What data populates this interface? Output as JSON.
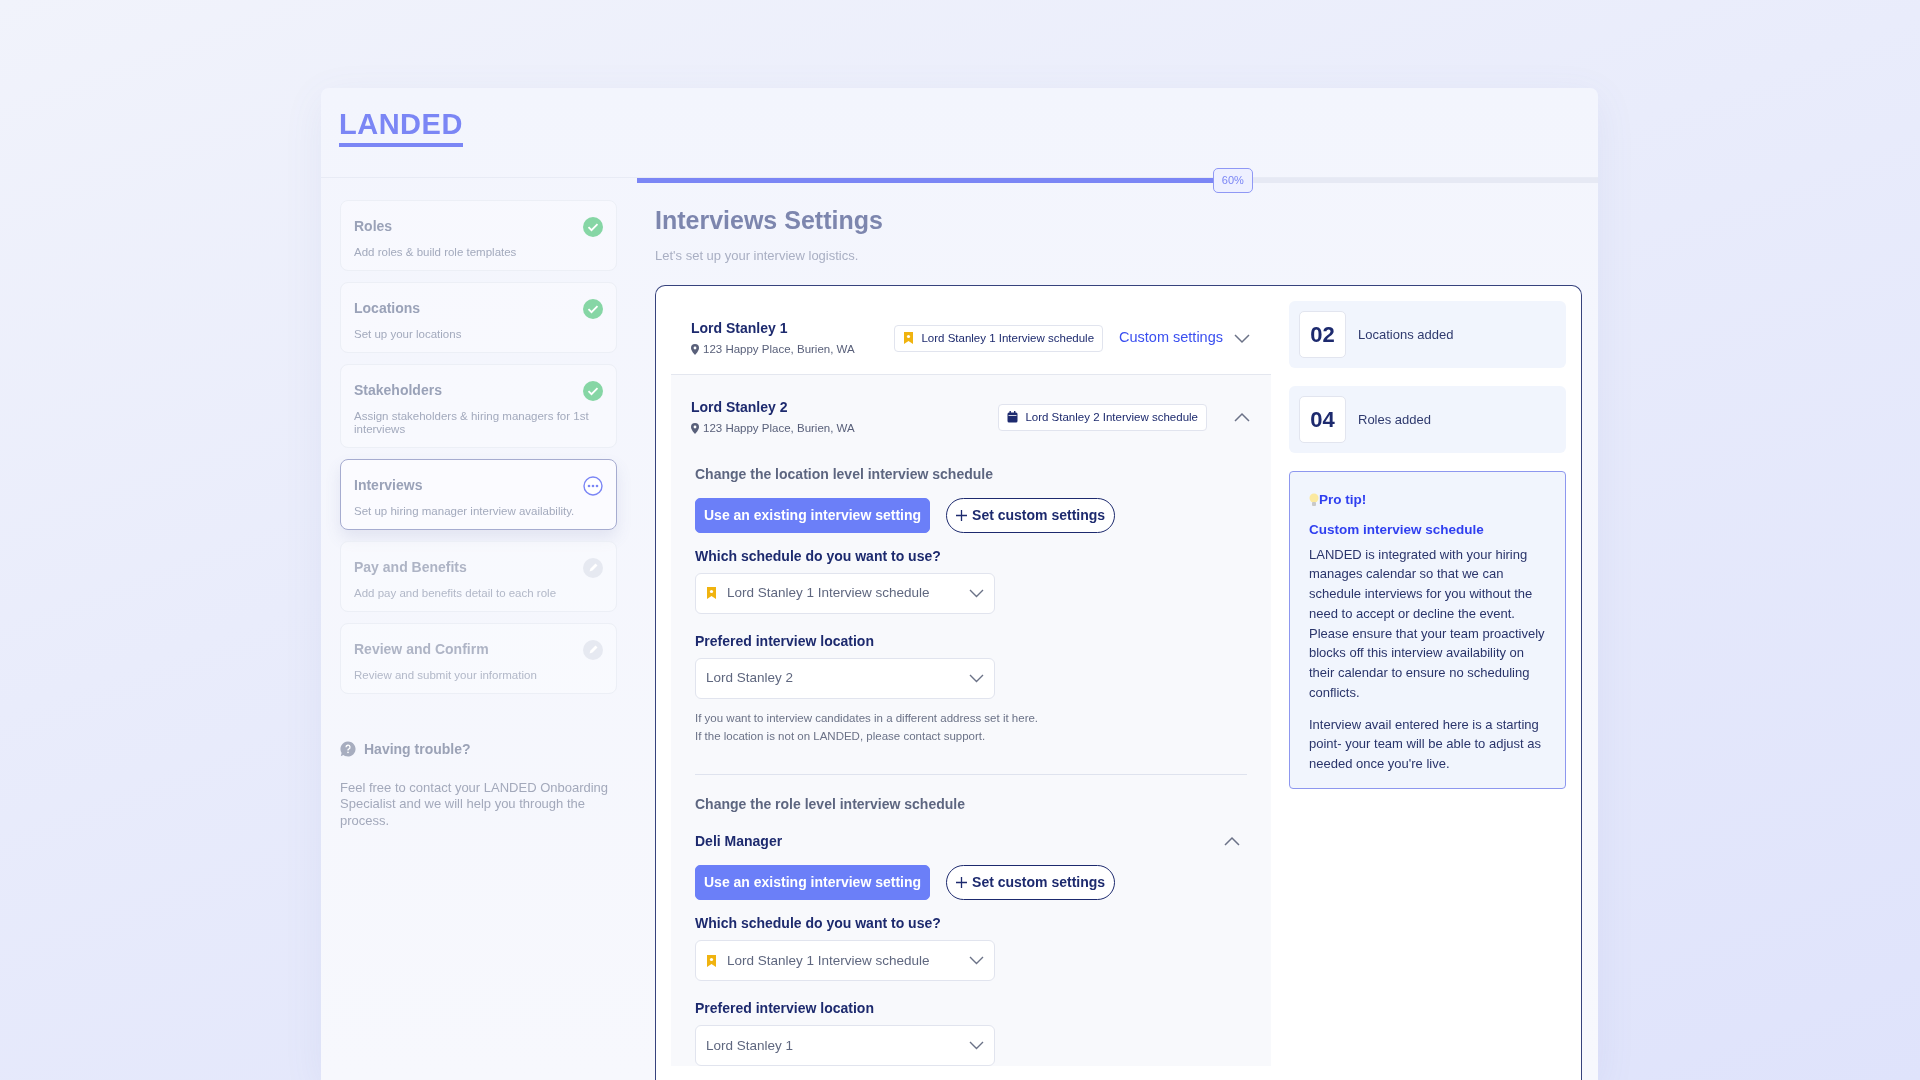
{
  "logo": "LANDED",
  "steps": [
    {
      "title": "Roles",
      "subtitle": "Add roles & build role templates",
      "completed": true,
      "selected": false
    },
    {
      "title": "Locations",
      "subtitle": "Set up your locations",
      "completed": true,
      "selected": false
    },
    {
      "title": "Stakeholders",
      "subtitle": "Assign stakeholders & hiring managers for 1st interviews",
      "completed": true,
      "selected": false
    },
    {
      "title": "Interviews",
      "subtitle": "Set up hiring manager interview availability.",
      "completed": false,
      "selected": true
    },
    {
      "title": "Pay and Benefits",
      "subtitle": "Add pay and benefits detail to each role",
      "completed": false,
      "selected": false
    },
    {
      "title": "Review and Confirm",
      "subtitle": "Review and submit your information",
      "completed": false,
      "selected": false
    }
  ],
  "help": {
    "title": "Having trouble?",
    "text": "Feel free to contact your LANDED Onboarding Specialist and we will help you through the process."
  },
  "progress": {
    "level": 0.6,
    "label": "60%"
  },
  "page": {
    "title": "Interviews Settings",
    "subtitle": "Let's set up your interview logistics."
  },
  "locations": [
    {
      "name": "Lord Stanley 1",
      "address": "123 Happy Place, Burien, WA",
      "schedule": {
        "kind": "bookmark",
        "label": "Lord Stanley 1 Interview schedule"
      },
      "link": "Custom settings",
      "expanded": false
    },
    {
      "name": "Lord Stanley 2",
      "address": "123 Happy Place, Burien, WA",
      "schedule": {
        "kind": "calendar",
        "label": "Lord Stanley 2 Interview schedule"
      },
      "expanded": true,
      "location_section": {
        "heading": "Change the location level interview schedule",
        "form": {
          "options": [
            {
              "label": "Use an existing interview setting",
              "selected": true
            },
            {
              "label": "Set custom settings",
              "selected": false
            }
          ],
          "schedule_label": "Which schedule do you want to use?",
          "schedule": {
            "kind": "bookmark",
            "value": "Lord Stanley 1 Interview schedule"
          },
          "location_label": "Prefered interview location",
          "location_value": "Lord Stanley 2",
          "help": [
            "If you want to interview candidates in a different address set it here.",
            "If the location is not on LANDED, please contact support."
          ]
        }
      },
      "role_section": {
        "heading": "Change the role level interview schedule",
        "roles": [
          {
            "name": "Deli Manager",
            "expanded": true,
            "form": {
              "options": [
                {
                  "label": "Use an existing interview setting",
                  "selected": true
                },
                {
                  "label": "Set custom settings",
                  "selected": false
                }
              ],
              "schedule_label": "Which schedule do you want to use?",
              "schedule": {
                "kind": "bookmark",
                "value": "Lord Stanley 1 Interview schedule"
              },
              "location_label": "Prefered interview location",
              "location_value": "Lord Stanley 1"
            }
          }
        ]
      }
    }
  ],
  "stats": [
    {
      "value": "02",
      "label": "Locations added"
    },
    {
      "value": "04",
      "label": "Roles added"
    }
  ],
  "tip": {
    "title": "Pro tip!",
    "heading": "Custom interview schedule",
    "paragraphs": [
      "LANDED is integrated with your hiring manages calendar so that we can schedule interviews for you without the need to accept or decline the event. Please ensure that your team proactively blocks off this interview availability on their calendar to ensure no scheduling conflicts.",
      "Interview avail entered here is a starting point- your team will be able to adjust as needed once you're live."
    ]
  }
}
